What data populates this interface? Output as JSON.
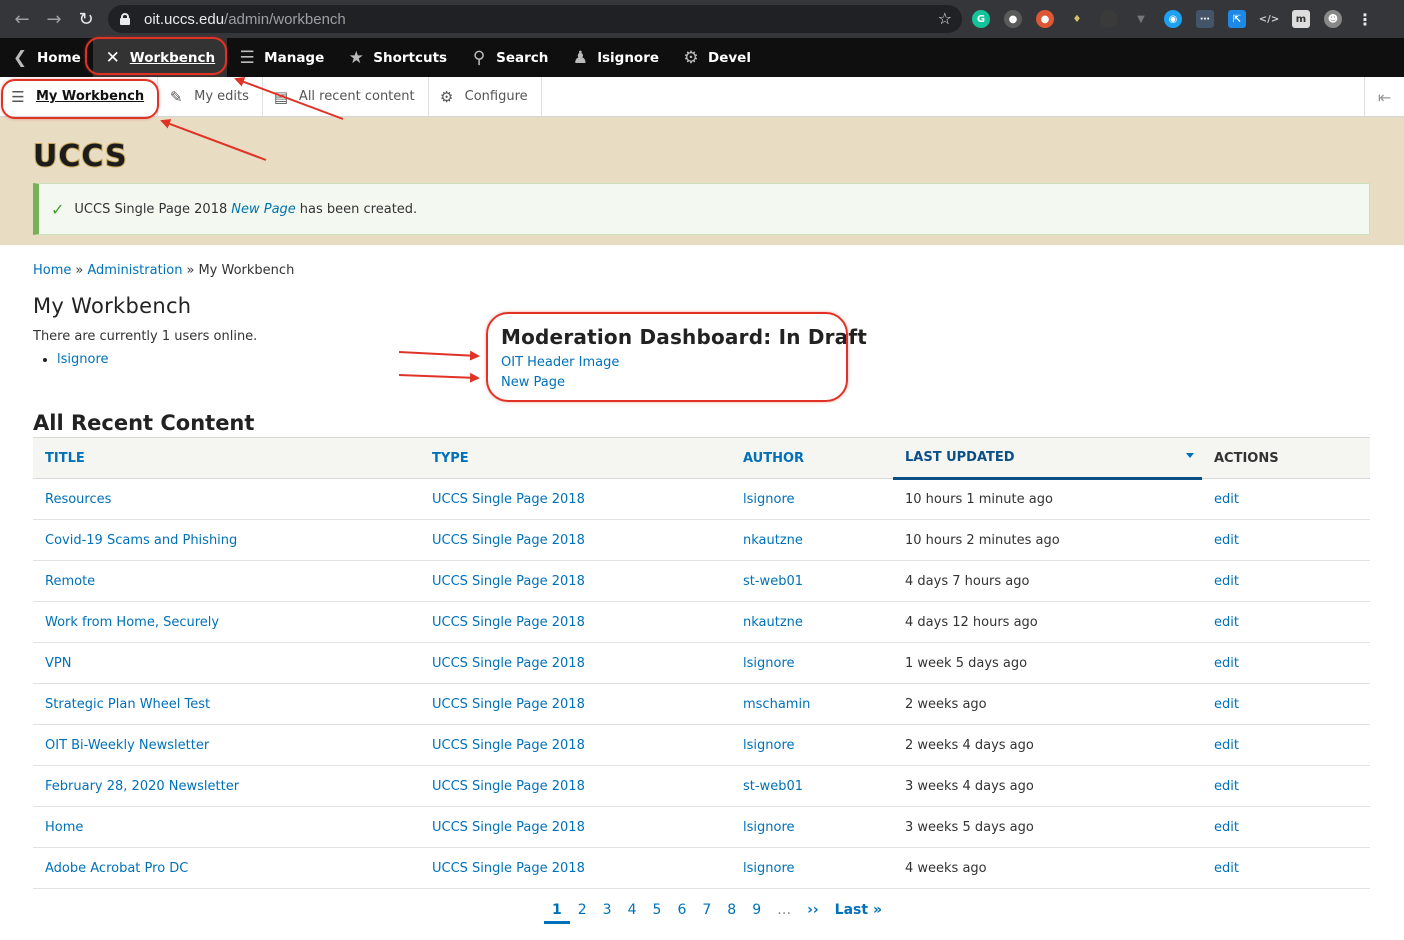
{
  "browser": {
    "url_host": "oit.uccs.edu",
    "url_path": "/admin/workbench"
  },
  "toolbar": {
    "items": [
      {
        "label": "Home",
        "icon": "back-circle-icon"
      },
      {
        "label": "Workbench",
        "icon": "tools-icon"
      },
      {
        "label": "Manage",
        "icon": "menu-icon"
      },
      {
        "label": "Shortcuts",
        "icon": "star-icon"
      },
      {
        "label": "Search",
        "icon": "search-icon"
      },
      {
        "label": "lsignore",
        "icon": "user-icon"
      },
      {
        "label": "Devel",
        "icon": "gear-icon"
      }
    ]
  },
  "tray": {
    "items": [
      {
        "label": "My Workbench",
        "icon": "checklist-icon"
      },
      {
        "label": "My edits",
        "icon": "pencil-icon"
      },
      {
        "label": "All recent content",
        "icon": "document-icon"
      },
      {
        "label": "Configure",
        "icon": "gear-icon"
      }
    ]
  },
  "header": {
    "logo": "UCCS",
    "message": {
      "prefix": "UCCS Single Page 2018",
      "link": "New Page",
      "suffix": "has been created."
    }
  },
  "breadcrumb": {
    "home": "Home",
    "admin": "Administration",
    "current": "My Workbench",
    "separator": "»"
  },
  "page_title": "My Workbench",
  "online": {
    "text": "There are currently 1 users online.",
    "users": [
      "lsignore"
    ]
  },
  "moderation": {
    "title": "Moderation Dashboard: In Draft",
    "items": [
      "OIT Header Image",
      "New Page"
    ]
  },
  "recent": {
    "title": "All Recent Content",
    "columns": {
      "title": "TITLE",
      "type": "TYPE",
      "author": "AUTHOR",
      "updated": "LAST UPDATED",
      "actions": "ACTIONS"
    },
    "rows": [
      {
        "title": "Resources",
        "type": "UCCS Single Page 2018",
        "author": "lsignore",
        "updated": "10 hours 1 minute ago",
        "action": "edit"
      },
      {
        "title": "Covid-19 Scams and Phishing",
        "type": "UCCS Single Page 2018",
        "author": "nkautzne",
        "updated": "10 hours 2 minutes ago",
        "action": "edit"
      },
      {
        "title": "Remote",
        "type": "UCCS Single Page 2018",
        "author": "st-web01",
        "updated": "4 days 7 hours ago",
        "action": "edit"
      },
      {
        "title": "Work from Home, Securely",
        "type": "UCCS Single Page 2018",
        "author": "nkautzne",
        "updated": "4 days 12 hours ago",
        "action": "edit"
      },
      {
        "title": "VPN",
        "type": "UCCS Single Page 2018",
        "author": "lsignore",
        "updated": "1 week 5 days ago",
        "action": "edit"
      },
      {
        "title": "Strategic Plan Wheel Test",
        "type": "UCCS Single Page 2018",
        "author": "mschamin",
        "updated": "2 weeks ago",
        "action": "edit"
      },
      {
        "title": "OIT Bi-Weekly Newsletter",
        "type": "UCCS Single Page 2018",
        "author": "lsignore",
        "updated": "2 weeks 4 days ago",
        "action": "edit"
      },
      {
        "title": "February 28, 2020 Newsletter",
        "type": "UCCS Single Page 2018",
        "author": "st-web01",
        "updated": "3 weeks 4 days ago",
        "action": "edit"
      },
      {
        "title": "Home",
        "type": "UCCS Single Page 2018",
        "author": "lsignore",
        "updated": "3 weeks 5 days ago",
        "action": "edit"
      },
      {
        "title": "Adobe Acrobat Pro DC",
        "type": "UCCS Single Page 2018",
        "author": "lsignore",
        "updated": "4 weeks ago",
        "action": "edit"
      }
    ]
  },
  "pager": {
    "pages": [
      "1",
      "2",
      "3",
      "4",
      "5",
      "6",
      "7",
      "8",
      "9"
    ],
    "ellipsis": "…",
    "next": "››",
    "last": "Last »"
  },
  "colors": {
    "link": "#0071b8",
    "annotation": "#e03326",
    "header_bg": "#e8dcc3",
    "toolbar_bg": "#0f0f0f"
  }
}
